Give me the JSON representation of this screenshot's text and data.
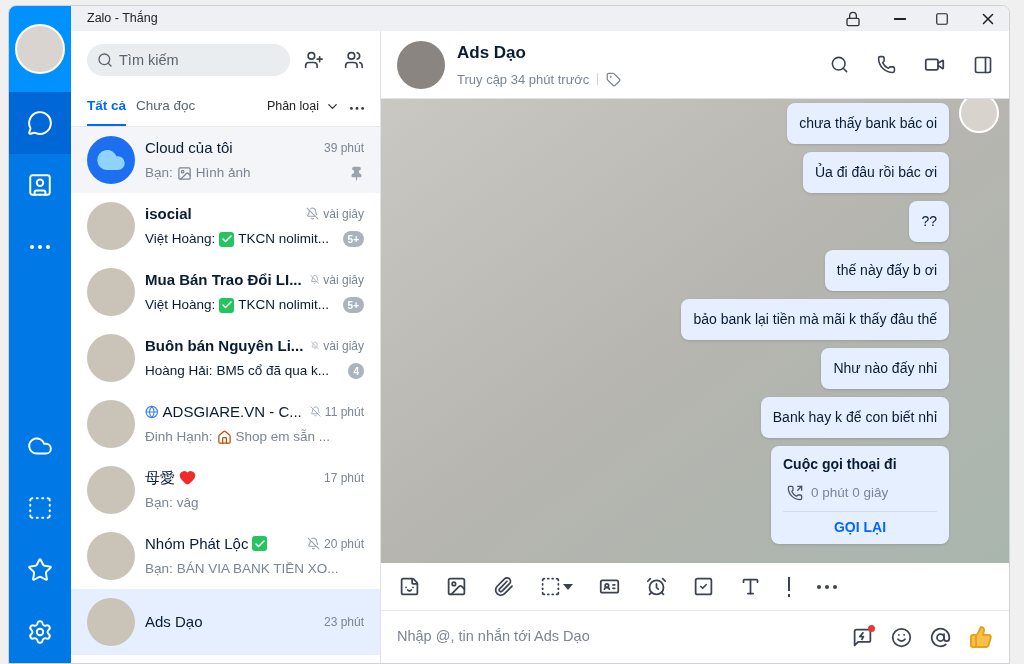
{
  "window": {
    "title": "Zalo - Thắng"
  },
  "rail": {
    "top": [
      {
        "kind": "chat",
        "selected": true
      },
      {
        "kind": "contacts",
        "selected": false
      },
      {
        "kind": "more",
        "selected": false
      }
    ],
    "bottom": [
      {
        "kind": "cloud",
        "selected": false
      },
      {
        "kind": "capture",
        "selected": false
      },
      {
        "kind": "star",
        "selected": false
      },
      {
        "kind": "settings",
        "selected": false
      }
    ]
  },
  "search": {
    "placeholder": "Tìm kiếm"
  },
  "tabs": [
    {
      "label": "Tất cả",
      "selected": true
    },
    {
      "label": "Chưa đọc",
      "selected": false
    }
  ],
  "filter": {
    "label": "Phân loại"
  },
  "conversations": [
    {
      "avatar": {
        "kind": "cloud"
      },
      "name": "Cloud của tôi",
      "time": "39 phút",
      "muted": false,
      "sender": "Bạn:",
      "preview_icon": {
        "kind": "image"
      },
      "preview": "Hình ảnh",
      "pinned": true,
      "unread": false,
      "selected": false
    },
    {
      "avatar": {
        "kind": "photo"
      },
      "name": "isocial",
      "time": "vài giây",
      "muted": true,
      "sender": "Việt Hoàng:",
      "preview_icon": {
        "kind": "check"
      },
      "preview": "TKCN nolimit...",
      "badge": "5+",
      "pinned": false,
      "unread": true,
      "selected": false
    },
    {
      "avatar": {
        "kind": "photo"
      },
      "name": "Mua Bán Trao Đổi LI...",
      "time": "vài giây",
      "muted": true,
      "sender": "Việt Hoàng:",
      "preview_icon": {
        "kind": "check"
      },
      "preview": "TKCN nolimit...",
      "badge": "5+",
      "pinned": false,
      "unread": true,
      "selected": false
    },
    {
      "avatar": {
        "kind": "photo"
      },
      "name": "Buôn bán Nguyên Li...",
      "time": "vài giây",
      "muted": true,
      "sender": "Hoàng Hải:",
      "preview": "BM5 cổ đã qua k...",
      "badge": "4",
      "pinned": false,
      "unread": true,
      "selected": false
    },
    {
      "avatar": {
        "kind": "photo"
      },
      "name_icon_before": {
        "kind": "globe"
      },
      "name": "ADSGIARE.VN - C...",
      "time": "11 phút",
      "muted": true,
      "sender": "Đinh Hạnh:",
      "preview_icon": {
        "kind": "house"
      },
      "preview": "Shop em sẵn ...",
      "pinned": false,
      "unread": false,
      "selected": false
    },
    {
      "avatar": {
        "kind": "photo"
      },
      "name": "母愛",
      "name_icon_after": {
        "kind": "heart"
      },
      "time": "17 phút",
      "muted": false,
      "sender": "Bạn:",
      "preview": "vâg",
      "pinned": false,
      "unread": false,
      "selected": false
    },
    {
      "avatar": {
        "kind": "photo"
      },
      "name": "Nhóm Phát Lộc",
      "name_icon_after": {
        "kind": "check"
      },
      "time": "20 phút",
      "muted": true,
      "sender": "Bạn:",
      "preview": "BÁN VIA BANK TIỀN XO...",
      "pinned": false,
      "unread": false,
      "selected": false
    },
    {
      "avatar": {
        "kind": "photo"
      },
      "name": "Ads Dạo",
      "time": "23 phút",
      "muted": false,
      "pinned": false,
      "unread": false,
      "selected": true
    }
  ],
  "chat": {
    "name": "Ads Dạo",
    "status": "Truy cập 34 phút trước",
    "messages": [
      {
        "kind": "text",
        "text": "chưa thấy bank bác oi",
        "avatar": true
      },
      {
        "kind": "text",
        "text": "Ủa đi đâu rồi bác ơi",
        "avatar": false
      },
      {
        "kind": "text",
        "text": "??",
        "avatar": false
      },
      {
        "kind": "text",
        "text": "thế này đấy b ơi",
        "avatar": false
      },
      {
        "kind": "text",
        "text": "bảo bank lại tiền mà mãi k thấy đâu thế",
        "avatar": false
      },
      {
        "kind": "text",
        "text": "Như nào đấy nhỉ",
        "avatar": false
      },
      {
        "kind": "text",
        "text": "Bank hay k để con biết nhỉ",
        "avatar": false
      },
      {
        "kind": "call",
        "title": "Cuộc gọi thoại đi",
        "duration": "0 phút 0 giây",
        "action": "GỌI LẠI",
        "avatar": false
      }
    ],
    "input": {
      "placeholder": "Nhập @, tin nhắn tới Ads Dạo"
    },
    "quick_notification": true
  }
}
